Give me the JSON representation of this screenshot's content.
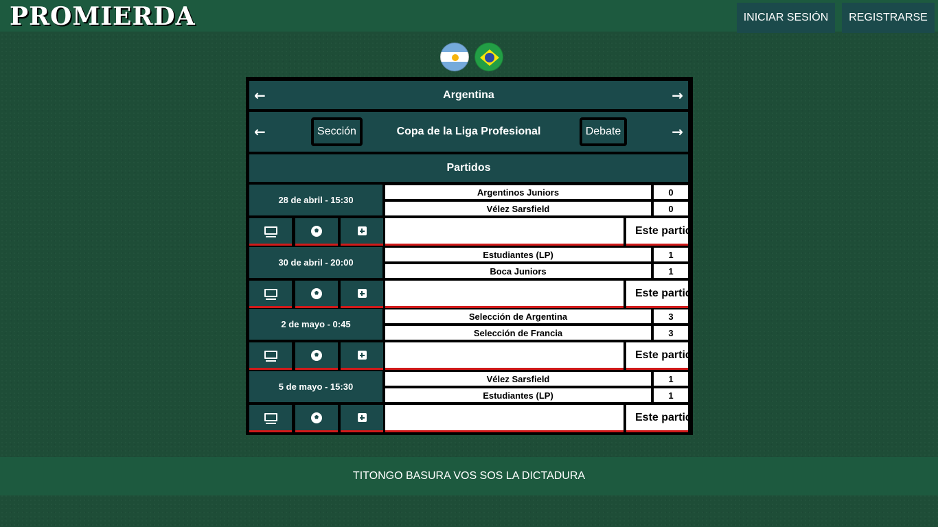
{
  "header": {
    "logo": "PROMIERDA",
    "login_label": "INICIAR SESIÓN",
    "register_label": "REGISTRARSE"
  },
  "flags": [
    "argentina-flag",
    "brazil-flag"
  ],
  "panel": {
    "country": "Argentina",
    "league": "Copa de la Liga Profesional",
    "section_label": "Sección",
    "debate_label": "Debate",
    "matches_title": "Partidos",
    "left_arrow": "←",
    "right_arrow": "→"
  },
  "matches": [
    {
      "date": "28 de abril - 15:30",
      "home": "Argentinos Juniors",
      "home_score": "0",
      "away": "Vélez Sarsfield",
      "away_score": "0",
      "message": "Este partido"
    },
    {
      "date": "30 de abril - 20:00",
      "home": "Estudiantes (LP)",
      "home_score": "1",
      "away": "Boca Juniors",
      "away_score": "1",
      "message": "Este partido"
    },
    {
      "date": "2 de mayo - 0:45",
      "home": "Selección de Argentina",
      "home_score": "3",
      "away": "Selección de Francia",
      "away_score": "3",
      "message": "Este partido"
    },
    {
      "date": "5 de mayo - 15:30",
      "home": "Vélez Sarsfield",
      "home_score": "1",
      "away": "Estudiantes (LP)",
      "away_score": "1",
      "message": "Este partido"
    }
  ],
  "footer": {
    "text": "TITONGO BASURA VOS SOS LA DICTADURA"
  },
  "colors": {
    "page_bg": "#1e4d37",
    "bar_bg": "#1d5a3f",
    "panel_cell": "#1b4a4b",
    "accent_red": "#d11a1a"
  }
}
